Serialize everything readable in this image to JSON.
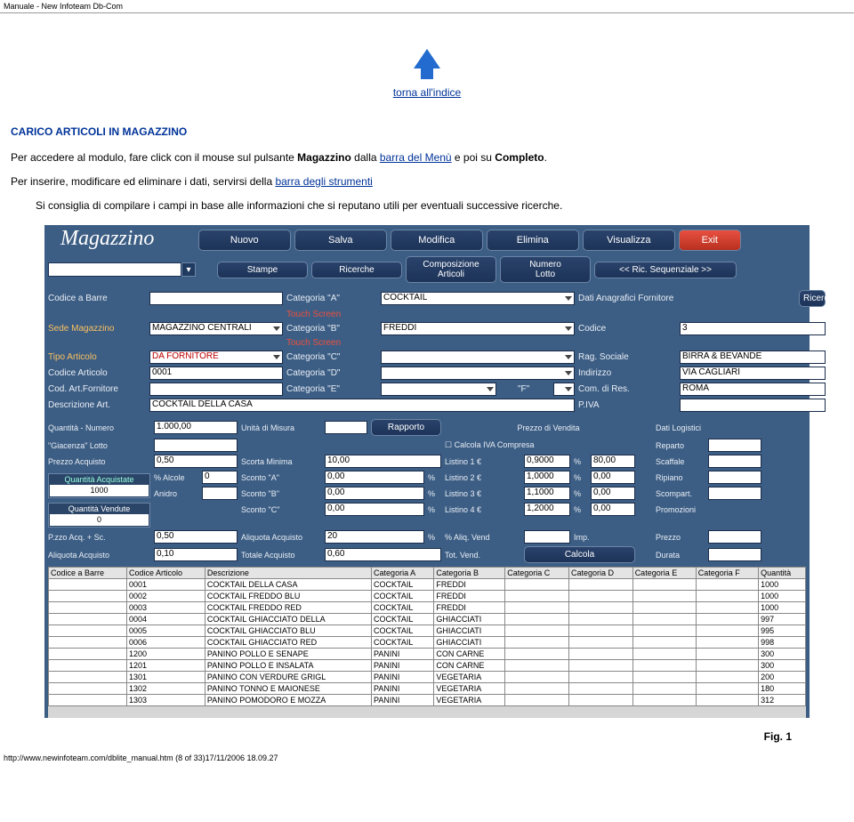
{
  "page_title": "Manuale - New Infoteam Db-Com",
  "back_link": "torna all'indice",
  "section_heading": "CARICO ARTICOLI IN MAGAZZINO",
  "para1_parts": {
    "p1": "Per accedere al modulo, fare click con il mouse sul pulsante ",
    "b1": "Magazzino",
    "p2": " dalla ",
    "l1": "barra del Menù",
    "p3": " e poi su ",
    "b2": "Completo",
    "p4": "."
  },
  "para2_parts": {
    "p1": "Per inserire, modificare ed eliminare i dati, servirsi della ",
    "l1": "barra degli strumenti"
  },
  "para3": "Si consiglia di compilare i campi in base alle informazioni che si reputano utili per eventuali successive ricerche.",
  "module_title": "Magazzino",
  "top_buttons": [
    "Nuovo",
    "Salva",
    "Modifica",
    "Elimina",
    "Visualizza"
  ],
  "exit_label": "Exit",
  "sub_buttons": [
    "Stampe",
    "Ricerche",
    "Composizione\nArticoli",
    "Numero\nLotto"
  ],
  "seq_label": "<<  Ric. Sequenziale  >>",
  "form": {
    "labels": {
      "codice_barre": "Codice a Barre",
      "sede_magazzino": "Sede Magazzino",
      "tipo_articolo": "Tipo Articolo",
      "codice_articolo": "Codice Articolo",
      "cod_art_fornitore": "Cod. Art.Fornitore",
      "descrizione_art": "Descrizione Art.",
      "cat_a": "Categoria \"A\"",
      "cat_b": "Categoria \"B\"",
      "cat_c": "Categoria \"C\"",
      "cat_d": "Categoria \"D\"",
      "cat_e": "Categoria \"E\"",
      "cat_f": "\"F\"",
      "touch": "Touch Screen",
      "dati_anag": "Dati Anagrafici Fornitore",
      "ricerca": "Ricerca",
      "codice": "Codice",
      "rag_sociale": "Rag. Sociale",
      "indirizzo": "Indirizzo",
      "com_res": "Com. di Res.",
      "piva": "P.IVA"
    },
    "values": {
      "sede_magazzino": "MAGAZZINO CENTRALI",
      "tipo_articolo": "DA FORNITORE",
      "codice_articolo": "0001",
      "cat_a": "COCKTAIL",
      "cat_b": "FREDDI",
      "descrizione_art": "COCKTAIL DELLA CASA",
      "codice": "3",
      "rag_sociale": "BIRRA & BEVANDE",
      "indirizzo": "VIA CAGLIARI",
      "com_res": "ROMA"
    }
  },
  "lower": {
    "labels": {
      "quantita_num": "Quantità - Numero",
      "giacenza_lotto": "\"Giacenza\"  Lotto",
      "prezzo_acquisto": "Prezzo Acquisto",
      "quant_acq": "Quantità Acquistate",
      "quant_vend": "Quantità Vendute",
      "pzzo_acq_sc": "P.zzo Acq. + Sc.",
      "aliquota_acq": "Aliquota Acquisto",
      "unita_misura": "Unità di Misura",
      "scorta_min": "Scorta Minima",
      "alcole": "% Alcole",
      "anidro": "Anidro",
      "sconto_a": "Sconto \"A\"",
      "sconto_b": "Sconto \"B\"",
      "sconto_c": "Sconto \"C\"",
      "aliq_acq_pct": "Aliquota Acquisto",
      "totale_acq": "Totale   Acquisto",
      "rapporto": "Rapporto",
      "prezzo_vendita": "Prezzo di Vendita",
      "calcola_iva": "Calcola IVA Compresa",
      "listino1": "Listino 1 €",
      "listino2": "Listino 2 €",
      "listino3": "Listino 3 €",
      "listino4": "Listino 4 €",
      "aliq_vend": "% Aliq. Vend",
      "tot_vend": "Tot.  Vend.",
      "imp": "Imp.",
      "calcola": "Calcola",
      "dati_log": "Dati Logistici",
      "reparto": "Reparto",
      "scaffale": "Scaffale",
      "ripiano": "Ripiano",
      "scompart": "Scompart.",
      "promozioni": "Promozioni",
      "prezzo": "Prezzo",
      "durata": "Durata",
      "pct": "%"
    },
    "values": {
      "quantita_num": "1.000,00",
      "prezzo_acquisto": "0,50",
      "quant_acq": "1000",
      "quant_vend": "0",
      "alcole": "0",
      "scorta_min": "10,00",
      "sconto_a": "0,00",
      "sconto_b": "0,00",
      "sconto_c": "0,00",
      "pzzo_acq_sc": "0,50",
      "aliq_acq_pct": "20",
      "aliquota_acq": "0,10",
      "totale_acq": "0,60",
      "listino1": "0,9000",
      "listino2": "1,0000",
      "listino3": "1,1000",
      "listino4": "1,2000",
      "pct1": "80,00",
      "pct2": "0,00",
      "pct3": "0,00",
      "pct4": "0,00"
    }
  },
  "table": {
    "headers": [
      "Codice a Barre",
      "Codice Articolo",
      "Descrizione",
      "Categoria A",
      "Categoria B",
      "Categoria C",
      "Categoria D",
      "Categoria E",
      "Categoria F",
      "Quantità"
    ],
    "rows": [
      [
        "",
        "0001",
        "COCKTAIL DELLA CASA",
        "COCKTAIL",
        "FREDDI",
        "",
        "",
        "",
        "",
        "1000"
      ],
      [
        "",
        "0002",
        "COCKTAIL FREDDO BLU",
        "COCKTAIL",
        "FREDDI",
        "",
        "",
        "",
        "",
        "1000"
      ],
      [
        "",
        "0003",
        "COCKTAIL FREDDO RED",
        "COCKTAIL",
        "FREDDI",
        "",
        "",
        "",
        "",
        "1000"
      ],
      [
        "",
        "0004",
        "COCKTAIL GHIACCIATO DELLA",
        "COCKTAIL",
        "GHIACCIATI",
        "",
        "",
        "",
        "",
        "997"
      ],
      [
        "",
        "0005",
        "COCKTAIL GHIACCIATO BLU",
        "COCKTAIL",
        "GHIACCIATI",
        "",
        "",
        "",
        "",
        "995"
      ],
      [
        "",
        "0006",
        "COCKTAIL GHIACCIATO RED",
        "COCKTAIL",
        "GHIACCIATI",
        "",
        "",
        "",
        "",
        "998"
      ],
      [
        "",
        "1200",
        "PANINO POLLO E SENAPE",
        "PANINI",
        "CON CARNE",
        "",
        "",
        "",
        "",
        "300"
      ],
      [
        "",
        "1201",
        "PANINO POLLO E INSALATA",
        "PANINI",
        "CON CARNE",
        "",
        "",
        "",
        "",
        "300"
      ],
      [
        "",
        "1301",
        "PANINO CON VERDURE GRIGL",
        "PANINI",
        "VEGETARIA",
        "",
        "",
        "",
        "",
        "200"
      ],
      [
        "",
        "1302",
        "PANINO TONNO E MAIONESE",
        "PANINI",
        "VEGETARIA",
        "",
        "",
        "",
        "",
        "180"
      ],
      [
        "",
        "1303",
        "PANINO POMODORO E MOZZA",
        "PANINI",
        "VEGETARIA",
        "",
        "",
        "",
        "",
        "312"
      ]
    ]
  },
  "fig_caption": "Fig. 1",
  "footer_url": "http://www.newinfoteam.com/dblite_manual.htm (8 of 33)17/11/2006 18.09.27"
}
